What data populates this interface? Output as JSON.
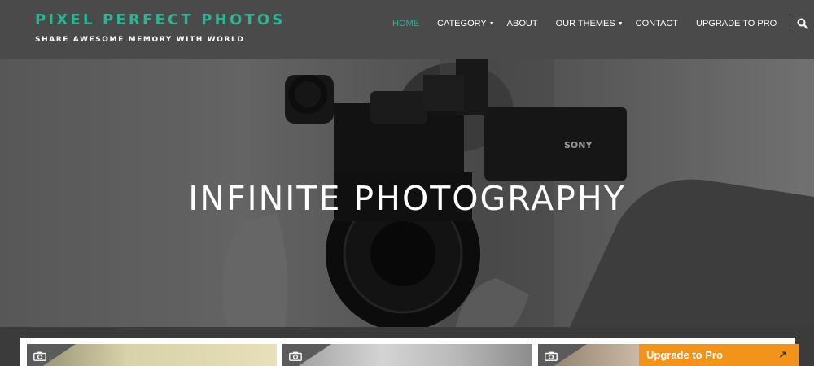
{
  "header": {
    "site_title": "PIXEL PERFECT PHOTOS",
    "tagline": "SHARE AWESOME MEMORY WITH WORLD"
  },
  "nav": {
    "items": [
      {
        "label": "HOME",
        "active": true
      },
      {
        "label": "CATEGORY",
        "dropdown": true
      },
      {
        "label": "ABOUT"
      },
      {
        "label": "OUR THEMES",
        "dropdown": true
      },
      {
        "label": "CONTACT"
      },
      {
        "label": "UPGRADE TO PRO"
      }
    ],
    "search_icon": "search-icon"
  },
  "hero": {
    "title": "INFINITE PHOTOGRAPHY",
    "camera_brand": "SONY"
  },
  "cards": [
    {
      "icon": "camera-icon"
    },
    {
      "icon": "camera-icon"
    },
    {
      "icon": "camera-icon"
    }
  ],
  "upgrade_banner": {
    "label": "Upgrade to Pro"
  },
  "colors": {
    "accent": "#2bb595",
    "header_bg": "#4a4a4a",
    "upgrade_bg": "#f2931a"
  }
}
